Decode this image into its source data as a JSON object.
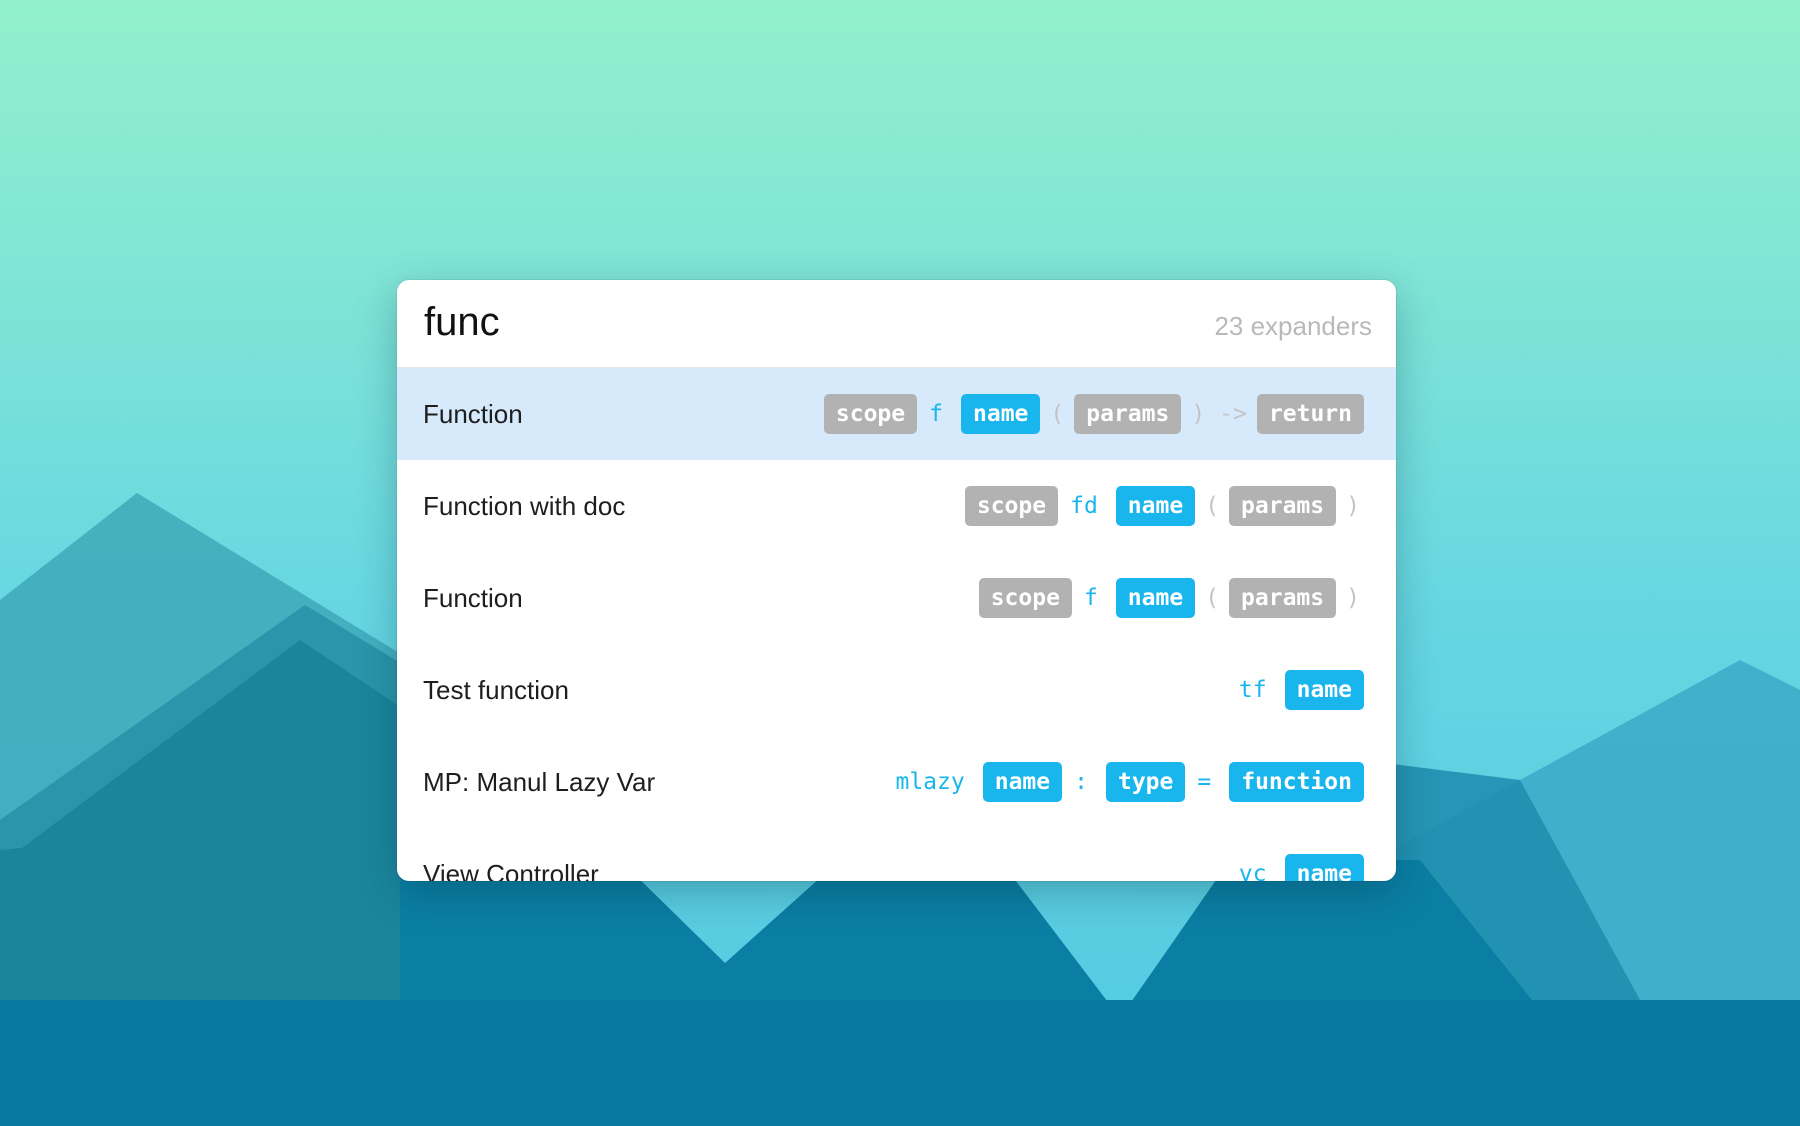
{
  "background": {
    "gradient_top": "#92f0cc",
    "gradient_bottom": "#51c8e2",
    "mountain_colors": [
      "#2f9aaf",
      "#1b869f",
      "#0a7fa3",
      "#3cb3cf"
    ]
  },
  "search": {
    "query": "func",
    "count_label": "23 expanders"
  },
  "colors": {
    "selected_row": "#d6eafc",
    "placeholder_gray": "#b2b2b2",
    "placeholder_blue": "#19b6ee",
    "keyword_blue": "#19b6ee",
    "punctuation": "#c4c4c4"
  },
  "results": [
    {
      "title": "Function",
      "selected": true,
      "tokens": [
        {
          "text": "scope",
          "kind": "ph-gray"
        },
        {
          "text": "f",
          "kind": "keyword"
        },
        {
          "text": "name",
          "kind": "ph-blue"
        },
        {
          "text": "(",
          "kind": "punct"
        },
        {
          "text": "params",
          "kind": "ph-gray"
        },
        {
          "text": ")",
          "kind": "punct"
        },
        {
          "text": "->",
          "kind": "punct"
        },
        {
          "text": "return",
          "kind": "ph-gray"
        }
      ]
    },
    {
      "title": "Function with doc",
      "selected": false,
      "tokens": [
        {
          "text": "scope",
          "kind": "ph-gray"
        },
        {
          "text": "fd",
          "kind": "keyword"
        },
        {
          "text": "name",
          "kind": "ph-blue"
        },
        {
          "text": "(",
          "kind": "punct"
        },
        {
          "text": "params",
          "kind": "ph-gray"
        },
        {
          "text": ")",
          "kind": "punct"
        }
      ]
    },
    {
      "title": "Function",
      "selected": false,
      "tokens": [
        {
          "text": "scope",
          "kind": "ph-gray"
        },
        {
          "text": "f",
          "kind": "keyword"
        },
        {
          "text": "name",
          "kind": "ph-blue"
        },
        {
          "text": "(",
          "kind": "punct"
        },
        {
          "text": "params",
          "kind": "ph-gray"
        },
        {
          "text": ")",
          "kind": "punct"
        }
      ]
    },
    {
      "title": "Test function",
      "selected": false,
      "tokens": [
        {
          "text": "tf",
          "kind": "keyword"
        },
        {
          "text": "name",
          "kind": "ph-blue"
        }
      ]
    },
    {
      "title": "MP: Manul Lazy Var",
      "selected": false,
      "tokens": [
        {
          "text": "mlazy",
          "kind": "keyword"
        },
        {
          "text": "name",
          "kind": "ph-blue"
        },
        {
          "text": ":",
          "kind": "keyword"
        },
        {
          "text": "type",
          "kind": "ph-blue"
        },
        {
          "text": "=",
          "kind": "keyword"
        },
        {
          "text": "function",
          "kind": "ph-blue"
        }
      ]
    },
    {
      "title": "View Controller",
      "selected": false,
      "tokens": [
        {
          "text": "vc",
          "kind": "keyword"
        },
        {
          "text": "name",
          "kind": "ph-blue"
        }
      ]
    }
  ]
}
